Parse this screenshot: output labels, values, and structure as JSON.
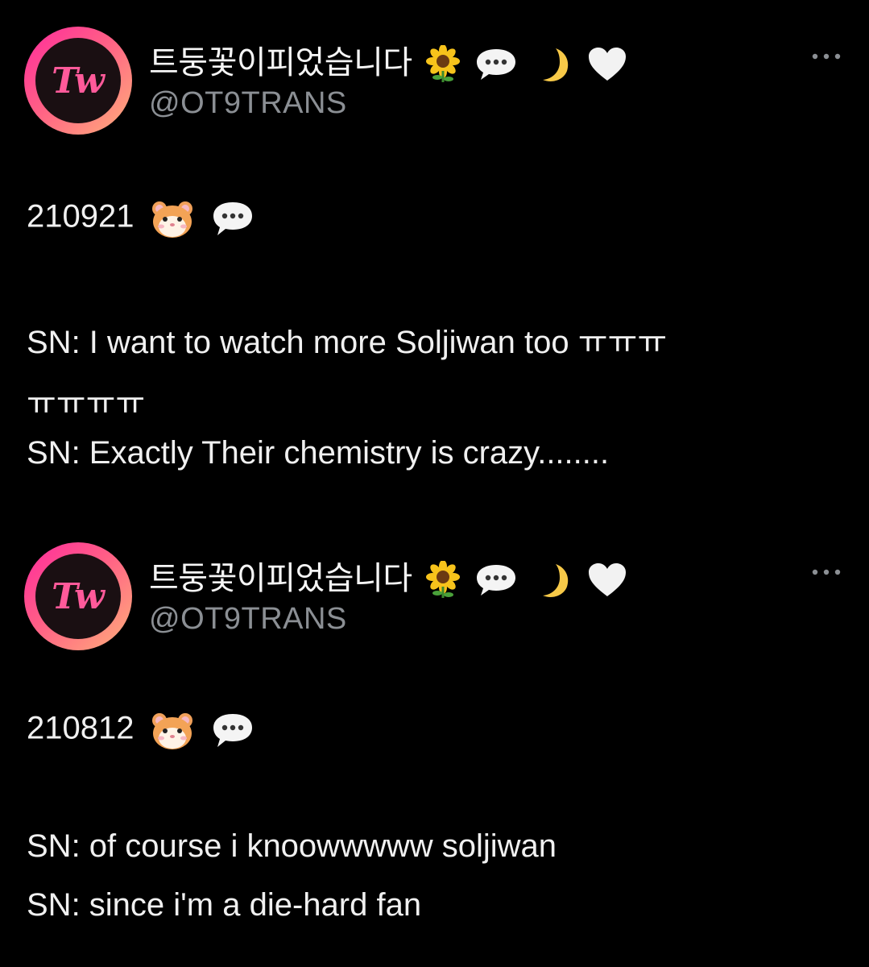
{
  "tweets": [
    {
      "display_name": "트둥꽃이피었습니다",
      "handle": "@OT9TRANS",
      "date": "210921",
      "line1": "SN: I want to watch more Soljiwan too ㅠㅠㅠ",
      "line1b": "ㅠㅠㅠㅠ",
      "line2": "SN: Exactly Their chemistry is crazy........",
      "avatar_logo": "Tw"
    },
    {
      "display_name": "트둥꽃이피었습니다",
      "handle": "@OT9TRANS",
      "date": "210812",
      "line1": "SN: of course i knoowwwww soljiwan",
      "line2": "SN: since i'm a die-hard fan",
      "avatar_logo": "Tw"
    }
  ],
  "name_icons": [
    "sunflower-icon",
    "speech-bubble-icon",
    "crescent-moon-icon",
    "white-heart-icon"
  ],
  "date_icons": [
    "hamster-icon",
    "speech-bubble-icon"
  ],
  "colors": {
    "background": "#000000",
    "text": "#f0f0f0",
    "handle": "#8b8f94",
    "avatar_ring_start": "#ff2a9d",
    "avatar_ring_end": "#ffb07a",
    "avatar_logo": "#ff5a9a"
  }
}
